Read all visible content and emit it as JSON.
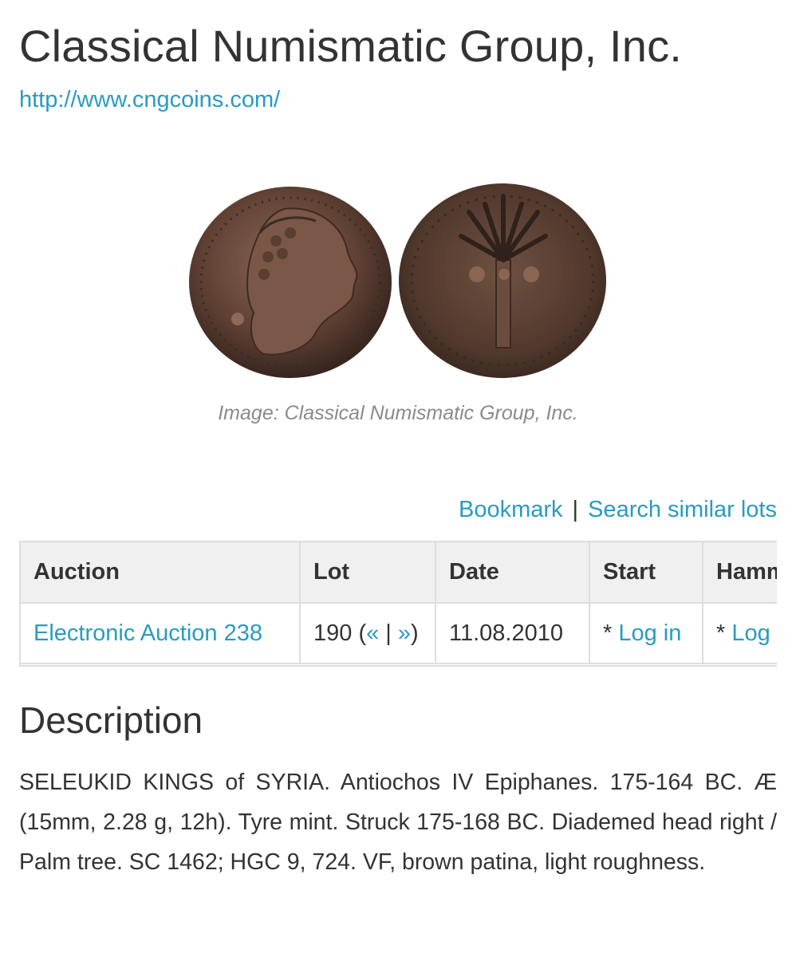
{
  "page": {
    "title": "Classical Numismatic Group, Inc.",
    "site_url": "http://www.cngcoins.com/"
  },
  "image": {
    "caption": "Image: Classical Numismatic Group, Inc.",
    "obverse_icon": "coin-obverse-head",
    "reverse_icon": "coin-reverse-palm-tree"
  },
  "actions": {
    "bookmark": "Bookmark",
    "separator": "|",
    "search_similar": "Search similar lots"
  },
  "table": {
    "headers": [
      "Auction",
      "Lot",
      "Date",
      "Start",
      "Hammer"
    ],
    "row": {
      "auction": "Electronic Auction 238",
      "lot_number": "190 (",
      "lot_prev": "«",
      "lot_sep": " | ",
      "lot_next": "»",
      "lot_close": ")",
      "date": "11.08.2010",
      "start_prefix": "* ",
      "start_link": "Log in",
      "hammer_prefix": "* ",
      "hammer_link": "Log in"
    }
  },
  "description": {
    "heading": "Description",
    "text": "SELEUKID KINGS of SYRIA. Antiochos IV Epiphanes. 175-164 BC. Æ (15mm, 2.28 g, 12h). Tyre mint. Struck 175-168 BC. Diademed head right / Palm tree. SC 1462; HGC 9, 724. VF, brown patina, light roughness."
  },
  "colors": {
    "link": "#2a9bbf",
    "text": "#333333",
    "table_header_bg": "#f0f0f0",
    "coin_bronze": "#6b4a3a"
  }
}
